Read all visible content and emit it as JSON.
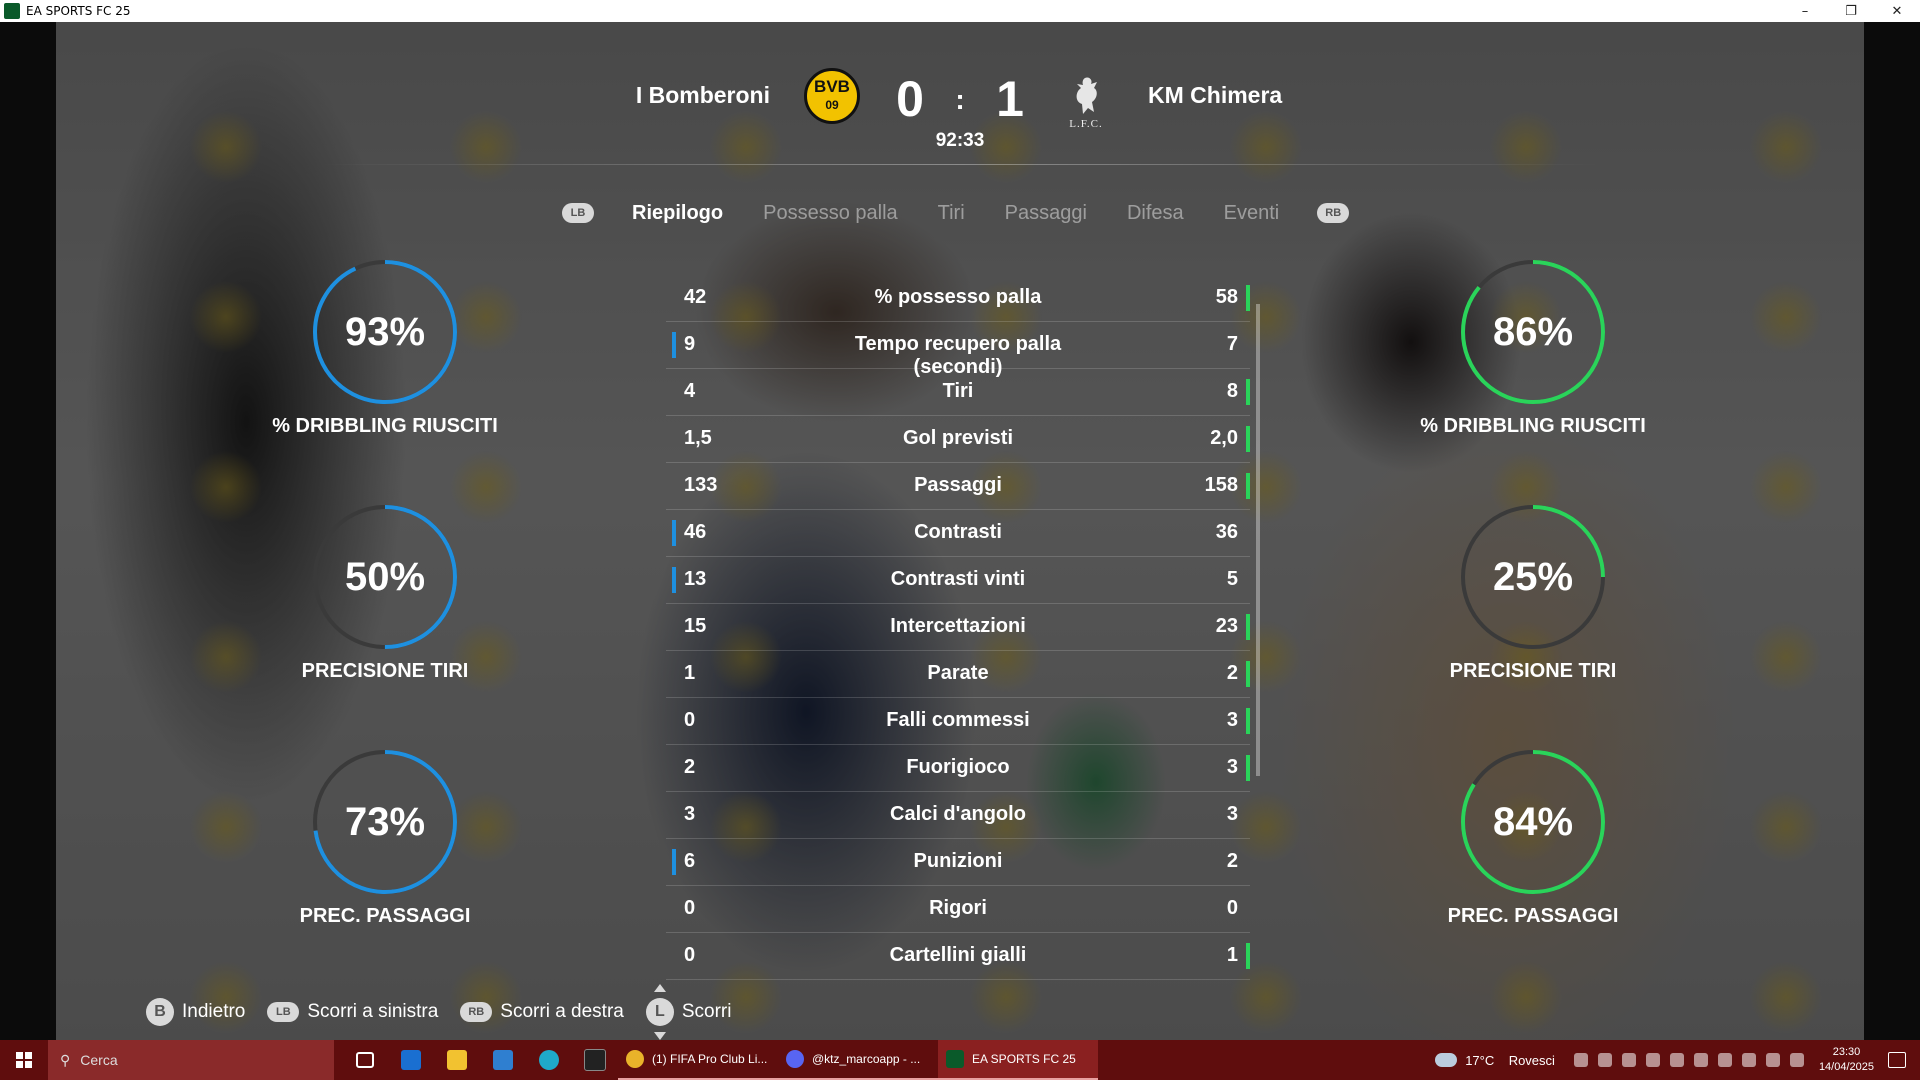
{
  "window": {
    "title": "EA SPORTS FC 25"
  },
  "match": {
    "home_team": "I Bomberoni",
    "away_team": "KM Chimera",
    "home_score": "0",
    "separator": ":",
    "away_score": "1",
    "clock": "92:33",
    "home_badge_text": "BVB\n09",
    "away_badge_text": "L.F.C."
  },
  "tabs": {
    "lb": "LB",
    "rb": "RB",
    "items": [
      "Riepilogo",
      "Possesso palla",
      "Tiri",
      "Passaggi",
      "Difesa",
      "Eventi"
    ],
    "active": "Riepilogo"
  },
  "colors": {
    "home": "#1e90e0",
    "away": "#2ad45a",
    "track": "#3a3a3a"
  },
  "home_gauges": [
    {
      "value": "93%",
      "pct": 93,
      "label": "% DRIBBLING RIUSCITI"
    },
    {
      "value": "50%",
      "pct": 50,
      "label": "PRECISIONE TIRI"
    },
    {
      "value": "73%",
      "pct": 73,
      "label": "PREC. PASSAGGI"
    }
  ],
  "away_gauges": [
    {
      "value": "86%",
      "pct": 86,
      "label": "% DRIBBLING RIUSCITI"
    },
    {
      "value": "25%",
      "pct": 25,
      "label": "PRECISIONE TIRI"
    },
    {
      "value": "84%",
      "pct": 84,
      "label": "PREC. PASSAGGI"
    }
  ],
  "stats": [
    {
      "home": "42",
      "label": "% possesso palla",
      "away": "58",
      "leader": "away"
    },
    {
      "home": "9",
      "label": "Tempo recupero palla (secondi)",
      "away": "7",
      "leader": "home"
    },
    {
      "home": "4",
      "label": "Tiri",
      "away": "8",
      "leader": "away"
    },
    {
      "home": "1,5",
      "label": "Gol previsti",
      "away": "2,0",
      "leader": "away"
    },
    {
      "home": "133",
      "label": "Passaggi",
      "away": "158",
      "leader": "away"
    },
    {
      "home": "46",
      "label": "Contrasti",
      "away": "36",
      "leader": "home"
    },
    {
      "home": "13",
      "label": "Contrasti vinti",
      "away": "5",
      "leader": "home"
    },
    {
      "home": "15",
      "label": "Intercettazioni",
      "away": "23",
      "leader": "away"
    },
    {
      "home": "1",
      "label": "Parate",
      "away": "2",
      "leader": "away"
    },
    {
      "home": "0",
      "label": "Falli commessi",
      "away": "3",
      "leader": "away"
    },
    {
      "home": "2",
      "label": "Fuorigioco",
      "away": "3",
      "leader": "away"
    },
    {
      "home": "3",
      "label": "Calci d'angolo",
      "away": "3",
      "leader": "none"
    },
    {
      "home": "6",
      "label": "Punizioni",
      "away": "2",
      "leader": "home"
    },
    {
      "home": "0",
      "label": "Rigori",
      "away": "0",
      "leader": "none"
    },
    {
      "home": "0",
      "label": "Cartellini gialli",
      "away": "1",
      "leader": "away"
    }
  ],
  "controls": {
    "back_key": "B",
    "back_label": "Indietro",
    "left_key": "LB",
    "left_label": "Scorri a sinistra",
    "right_key": "RB",
    "right_label": "Scorri a destra",
    "scroll_key": "L",
    "scroll_label": "Scorri"
  },
  "taskbar": {
    "search_placeholder": "Cerca",
    "tasks": [
      "(1) FIFA Pro Club Li...",
      "@ktz_marcoapp - ...",
      "EA SPORTS FC 25"
    ],
    "weather_temp": "17°C",
    "weather_text": "Rovesci",
    "time": "23:30",
    "date": "14/04/2025"
  }
}
